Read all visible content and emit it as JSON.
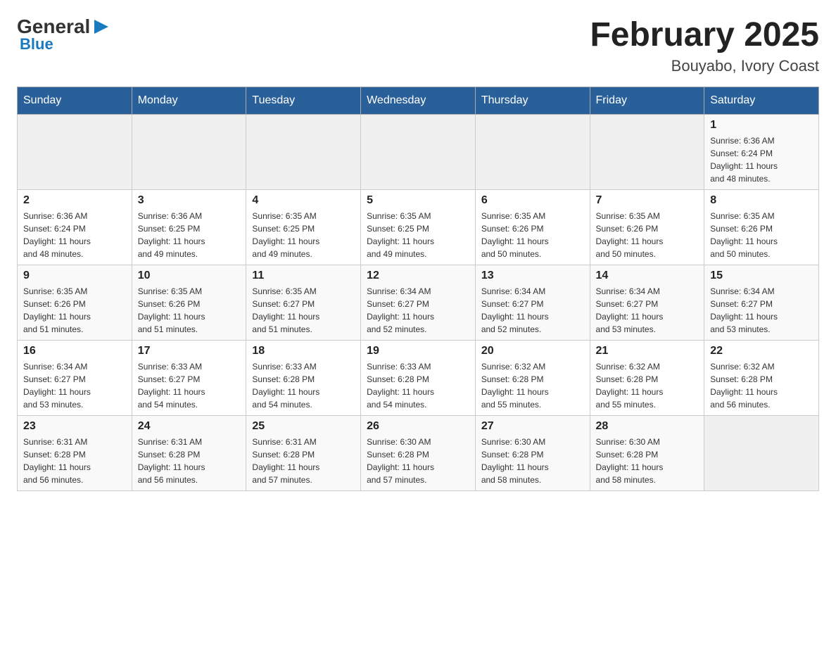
{
  "header": {
    "logo_text_general": "General",
    "logo_text_blue": "Blue",
    "month_year": "February 2025",
    "location": "Bouyabo, Ivory Coast"
  },
  "days_of_week": [
    "Sunday",
    "Monday",
    "Tuesday",
    "Wednesday",
    "Thursday",
    "Friday",
    "Saturday"
  ],
  "weeks": [
    {
      "days": [
        {
          "number": "",
          "info": ""
        },
        {
          "number": "",
          "info": ""
        },
        {
          "number": "",
          "info": ""
        },
        {
          "number": "",
          "info": ""
        },
        {
          "number": "",
          "info": ""
        },
        {
          "number": "",
          "info": ""
        },
        {
          "number": "1",
          "info": "Sunrise: 6:36 AM\nSunset: 6:24 PM\nDaylight: 11 hours\nand 48 minutes."
        }
      ]
    },
    {
      "days": [
        {
          "number": "2",
          "info": "Sunrise: 6:36 AM\nSunset: 6:24 PM\nDaylight: 11 hours\nand 48 minutes."
        },
        {
          "number": "3",
          "info": "Sunrise: 6:36 AM\nSunset: 6:25 PM\nDaylight: 11 hours\nand 49 minutes."
        },
        {
          "number": "4",
          "info": "Sunrise: 6:35 AM\nSunset: 6:25 PM\nDaylight: 11 hours\nand 49 minutes."
        },
        {
          "number": "5",
          "info": "Sunrise: 6:35 AM\nSunset: 6:25 PM\nDaylight: 11 hours\nand 49 minutes."
        },
        {
          "number": "6",
          "info": "Sunrise: 6:35 AM\nSunset: 6:26 PM\nDaylight: 11 hours\nand 50 minutes."
        },
        {
          "number": "7",
          "info": "Sunrise: 6:35 AM\nSunset: 6:26 PM\nDaylight: 11 hours\nand 50 minutes."
        },
        {
          "number": "8",
          "info": "Sunrise: 6:35 AM\nSunset: 6:26 PM\nDaylight: 11 hours\nand 50 minutes."
        }
      ]
    },
    {
      "days": [
        {
          "number": "9",
          "info": "Sunrise: 6:35 AM\nSunset: 6:26 PM\nDaylight: 11 hours\nand 51 minutes."
        },
        {
          "number": "10",
          "info": "Sunrise: 6:35 AM\nSunset: 6:26 PM\nDaylight: 11 hours\nand 51 minutes."
        },
        {
          "number": "11",
          "info": "Sunrise: 6:35 AM\nSunset: 6:27 PM\nDaylight: 11 hours\nand 51 minutes."
        },
        {
          "number": "12",
          "info": "Sunrise: 6:34 AM\nSunset: 6:27 PM\nDaylight: 11 hours\nand 52 minutes."
        },
        {
          "number": "13",
          "info": "Sunrise: 6:34 AM\nSunset: 6:27 PM\nDaylight: 11 hours\nand 52 minutes."
        },
        {
          "number": "14",
          "info": "Sunrise: 6:34 AM\nSunset: 6:27 PM\nDaylight: 11 hours\nand 53 minutes."
        },
        {
          "number": "15",
          "info": "Sunrise: 6:34 AM\nSunset: 6:27 PM\nDaylight: 11 hours\nand 53 minutes."
        }
      ]
    },
    {
      "days": [
        {
          "number": "16",
          "info": "Sunrise: 6:34 AM\nSunset: 6:27 PM\nDaylight: 11 hours\nand 53 minutes."
        },
        {
          "number": "17",
          "info": "Sunrise: 6:33 AM\nSunset: 6:27 PM\nDaylight: 11 hours\nand 54 minutes."
        },
        {
          "number": "18",
          "info": "Sunrise: 6:33 AM\nSunset: 6:28 PM\nDaylight: 11 hours\nand 54 minutes."
        },
        {
          "number": "19",
          "info": "Sunrise: 6:33 AM\nSunset: 6:28 PM\nDaylight: 11 hours\nand 54 minutes."
        },
        {
          "number": "20",
          "info": "Sunrise: 6:32 AM\nSunset: 6:28 PM\nDaylight: 11 hours\nand 55 minutes."
        },
        {
          "number": "21",
          "info": "Sunrise: 6:32 AM\nSunset: 6:28 PM\nDaylight: 11 hours\nand 55 minutes."
        },
        {
          "number": "22",
          "info": "Sunrise: 6:32 AM\nSunset: 6:28 PM\nDaylight: 11 hours\nand 56 minutes."
        }
      ]
    },
    {
      "days": [
        {
          "number": "23",
          "info": "Sunrise: 6:31 AM\nSunset: 6:28 PM\nDaylight: 11 hours\nand 56 minutes."
        },
        {
          "number": "24",
          "info": "Sunrise: 6:31 AM\nSunset: 6:28 PM\nDaylight: 11 hours\nand 56 minutes."
        },
        {
          "number": "25",
          "info": "Sunrise: 6:31 AM\nSunset: 6:28 PM\nDaylight: 11 hours\nand 57 minutes."
        },
        {
          "number": "26",
          "info": "Sunrise: 6:30 AM\nSunset: 6:28 PM\nDaylight: 11 hours\nand 57 minutes."
        },
        {
          "number": "27",
          "info": "Sunrise: 6:30 AM\nSunset: 6:28 PM\nDaylight: 11 hours\nand 58 minutes."
        },
        {
          "number": "28",
          "info": "Sunrise: 6:30 AM\nSunset: 6:28 PM\nDaylight: 11 hours\nand 58 minutes."
        },
        {
          "number": "",
          "info": ""
        }
      ]
    }
  ]
}
